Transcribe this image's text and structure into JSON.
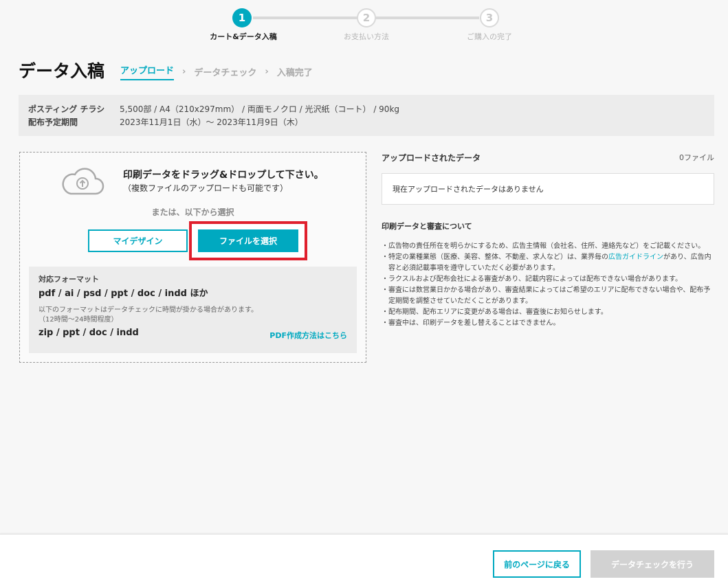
{
  "stepper": {
    "steps": [
      {
        "number": "1",
        "label": "カート&データ入稿",
        "state": "active"
      },
      {
        "number": "2",
        "label": "お支払い方法",
        "state": "inactive"
      },
      {
        "number": "3",
        "label": "ご購入の完了",
        "state": "inactive"
      }
    ]
  },
  "header": {
    "title": "データ入稿",
    "breadcrumbs": [
      {
        "label": "アップロード",
        "active": true
      },
      {
        "label": "データチェック",
        "active": false
      },
      {
        "label": "入稿完了",
        "active": false
      }
    ],
    "separator": "›"
  },
  "summary": {
    "product_label": "ポスティング チラシ",
    "product_value": "5,500部 /  A4（210x297mm） / 両面モノクロ / 光沢紙（コート） / 90kg",
    "period_label": "配布予定期間",
    "period_value": "2023年11月1日（水）～ 2023年11月9日（木）"
  },
  "upload": {
    "drop_main": "印刷データをドラッグ&ドロップして下さい。",
    "drop_sub": "（複数ファイルのアップロードも可能です）",
    "or_text": "または、以下から選択",
    "mydesign_button": "マイデザイン",
    "file_button": "ファイルを選択",
    "formats_label": "対応フォーマット",
    "formats_list": "pdf / ai / psd / ppt / doc / indd ほか",
    "slow_note_line1": "以下のフォーマットはデータチェックに時間が掛かる場合があります。",
    "slow_note_line2": "（12時間～24時間程度）",
    "slow_formats": "zip / ppt / doc / indd",
    "pdf_link": "PDF作成方法はこちら"
  },
  "uploaded": {
    "title": "アップロードされたデータ",
    "count": "0ファイル",
    "empty_message": "現在アップロードされたデータはありません"
  },
  "notice": {
    "title": "印刷データと審査について",
    "item1": "・広告物の責任所在を明らかにするため、広告主情報（会社名、住所、連絡先など）をご記載ください。",
    "item2_before": "・特定の業種業態（医療、美容、整体、不動産、求人など）は、業界毎の",
    "item2_link": "広告ガイドライン",
    "item2_after": "があり、広告内容と必須記載事項を遵守していただく必要があります。",
    "item3": "・ラクスルおよび配布会社による審査があり、記載内容によっては配布できない場合があります。",
    "item4": "・審査には数営業日かかる場合があり、審査結果によってはご希望のエリアに配布できない場合や、配布予定期間を調整させていただくことがあります。",
    "item5": "・配布期間、配布エリアに変更がある場合は、審査後にお知らせします。",
    "item6": "・審査中は、印刷データを差し替えることはできません。"
  },
  "footer": {
    "back_button": "前のページに戻る",
    "check_button": "データチェックを行う"
  },
  "colors": {
    "accent": "#00a9c0",
    "highlight": "#e0202d",
    "disabled": "#d2d2d2"
  }
}
